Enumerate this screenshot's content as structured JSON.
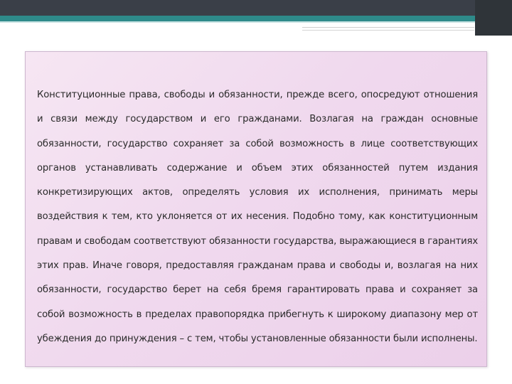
{
  "slide": {
    "paragraph": "Конституционные права, свободы и обязанности, прежде всего, опосредуют отношения и связи между государством и его гражданами. Возлагая на граждан основные обязанности, государство сохраняет за собой возможность в лице соответствующих органов устанавливать содержание и объем этих обязанностей путем издания конкретизирующих актов, определять условия их исполнения, принимать меры воздействия к тем, кто уклоняется от их несения. Подобно тому, как конституционным правам и свободам соответствуют обязанности государства, выражающиеся в гарантиях этих прав. Иначе говоря, предоставляя гражданам права и свободы и, возлагая на них обязанности, государство берет на себя бремя гарантировать права и сохраняет за собой возможность в пределах правопорядка прибегнуть к широкому диапазону мер от убеждения до принуждения – с тем, чтобы установленные обязанности были исполнены."
  },
  "colors": {
    "header_dark": "#3a3f48",
    "header_teal": "#2e8a8a",
    "box_fill": "#f0d9ee",
    "box_border": "#cdb7cf",
    "text": "#2a2a2a"
  }
}
